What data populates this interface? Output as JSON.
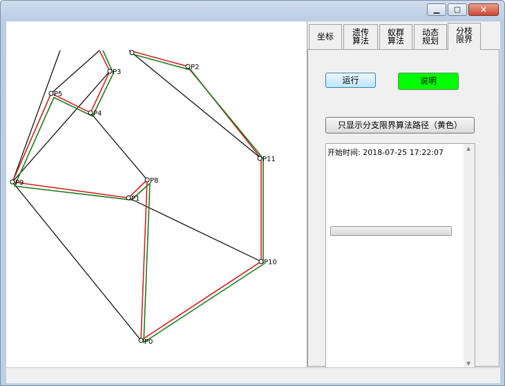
{
  "window": {
    "minimize_glyph": "▁",
    "maximize_glyph": "▢",
    "close_glyph": "✕"
  },
  "tabs": [
    {
      "label": "坐标",
      "active": false
    },
    {
      "label": "遗传\n算法",
      "active": false
    },
    {
      "label": "蚁群\n算法",
      "active": false
    },
    {
      "label": "动态\n规划",
      "active": false
    },
    {
      "label": "分枝\n限界",
      "active": true
    }
  ],
  "buttons": {
    "run_label": "运行",
    "help_label": "说明",
    "show_path_label": "只显示分支限界算法路径（黄色）"
  },
  "log": {
    "start_text": "开始时间: 2018-07-25 17:22:07"
  },
  "progress": {
    "fraction": 0
  },
  "points": [
    "P0",
    "P1",
    "P2",
    "P3",
    "P4",
    "P5",
    "P8",
    "P9",
    "P10",
    "P11"
  ],
  "colors": {
    "red_path": "#d42020",
    "green_path": "#1a7a1a",
    "black_path": "#000000",
    "run_button_bg": "#bee6fd",
    "help_button_bg": "#00ff00"
  },
  "icons": [
    "minimize-icon",
    "maximize-icon",
    "close-icon",
    "point-marker-icon",
    "scroll-arrow-icon"
  ]
}
